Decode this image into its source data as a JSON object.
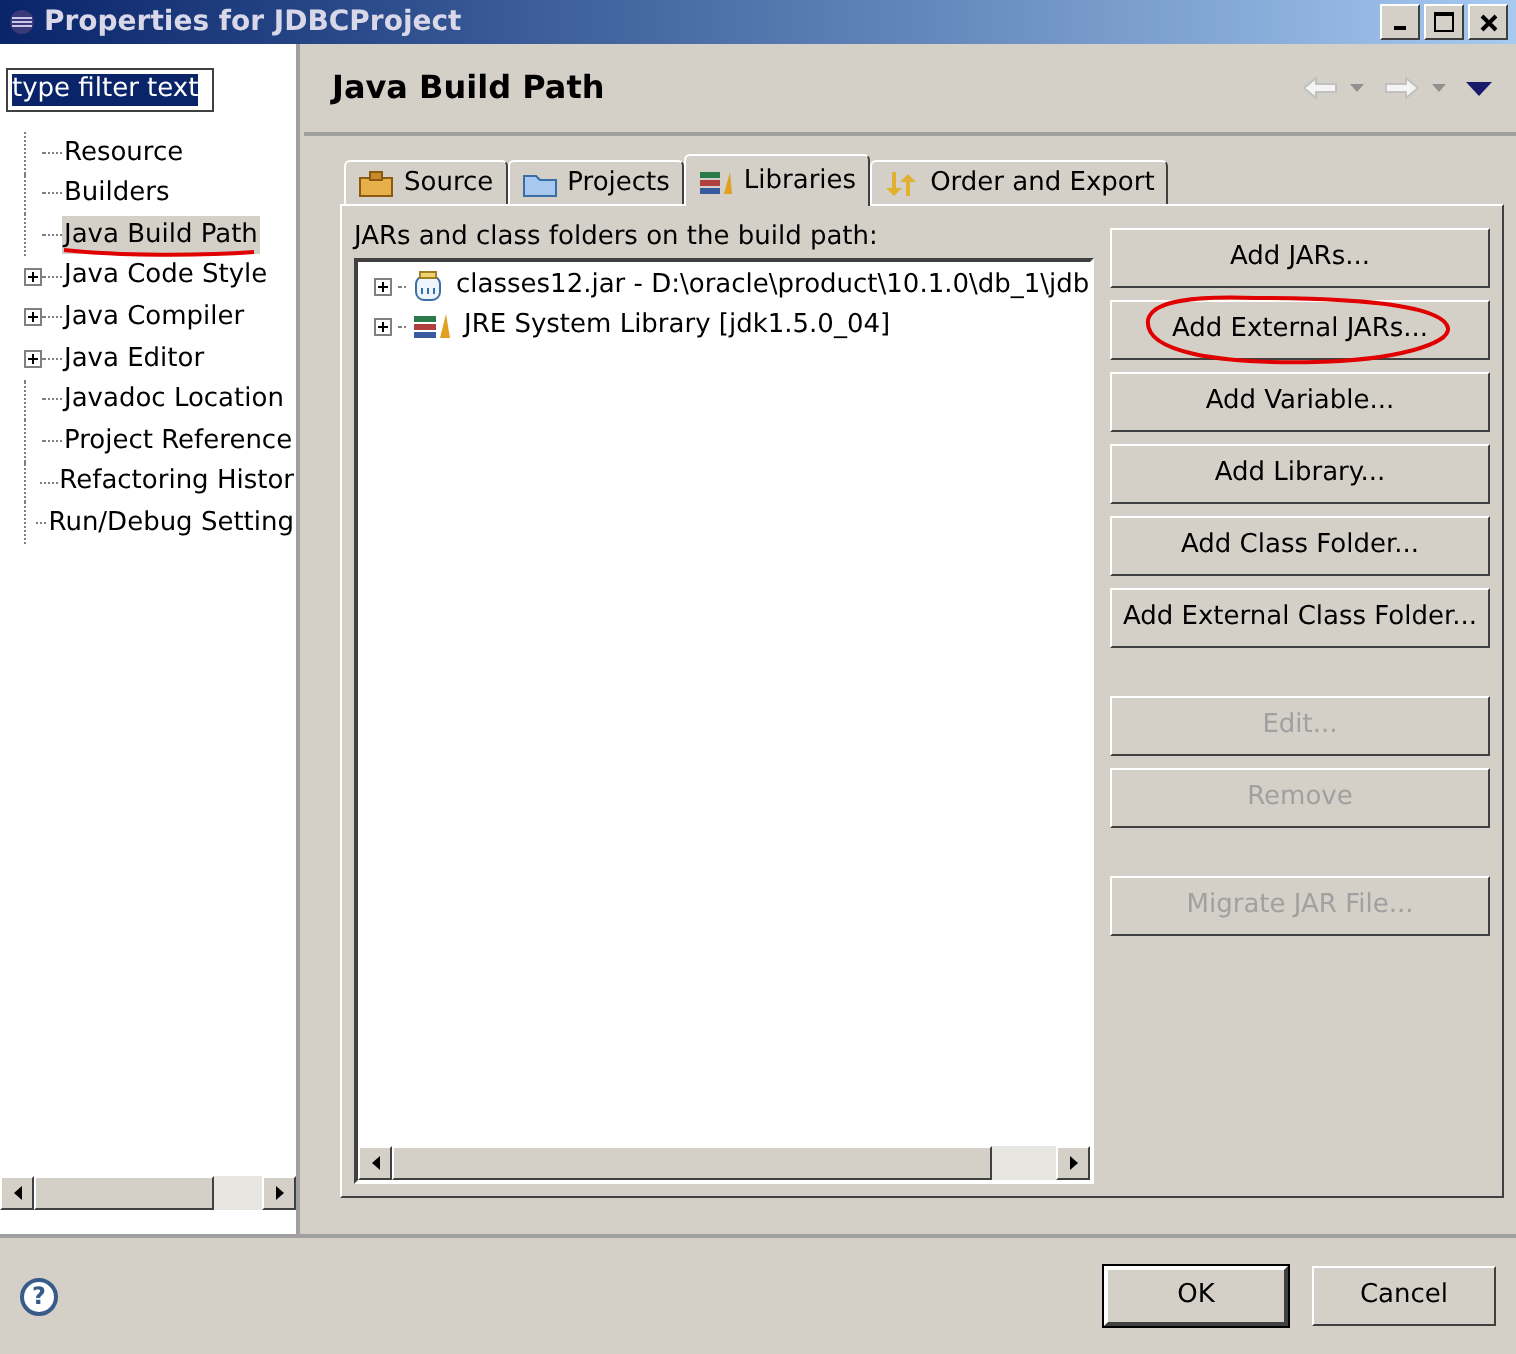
{
  "window": {
    "title": "Properties for JDBCProject"
  },
  "filter": {
    "value": "type filter text",
    "selected": true
  },
  "tree": [
    {
      "label": "Resource",
      "expandable": false,
      "selected": false
    },
    {
      "label": "Builders",
      "expandable": false,
      "selected": false
    },
    {
      "label": "Java Build Path",
      "expandable": false,
      "selected": true
    },
    {
      "label": "Java Code Style",
      "expandable": true,
      "selected": false
    },
    {
      "label": "Java Compiler",
      "expandable": true,
      "selected": false
    },
    {
      "label": "Java Editor",
      "expandable": true,
      "selected": false
    },
    {
      "label": "Javadoc Location",
      "expandable": false,
      "selected": false
    },
    {
      "label": "Project Reference",
      "expandable": false,
      "selected": false
    },
    {
      "label": "Refactoring Histor",
      "expandable": false,
      "selected": false
    },
    {
      "label": "Run/Debug Setting",
      "expandable": false,
      "selected": false
    }
  ],
  "page": {
    "title": "Java Build Path"
  },
  "tabs": [
    {
      "label": "Source",
      "kind": "source",
      "selected": false
    },
    {
      "label": "Projects",
      "kind": "projects",
      "selected": false
    },
    {
      "label": "Libraries",
      "kind": "libraries",
      "selected": true
    },
    {
      "label": "Order and Export",
      "kind": "order",
      "selected": false
    }
  ],
  "list_label": "JARs and class folders on the build path:",
  "entries": [
    {
      "label": "classes12.jar - D:\\oracle\\product\\10.1.0\\db_1\\jdb",
      "kind": "jar"
    },
    {
      "label": "JRE System Library [jdk1.5.0_04]",
      "kind": "library"
    }
  ],
  "button_groups": [
    [
      {
        "label": "Add JARs...",
        "disabled": false
      },
      {
        "label": "Add External JARs...",
        "disabled": false
      },
      {
        "label": "Add Variable...",
        "disabled": false
      },
      {
        "label": "Add Library...",
        "disabled": false
      },
      {
        "label": "Add Class Folder...",
        "disabled": false
      },
      {
        "label": "Add External Class Folder...",
        "disabled": false
      }
    ],
    [
      {
        "label": "Edit...",
        "disabled": true
      },
      {
        "label": "Remove",
        "disabled": true
      }
    ],
    [
      {
        "label": "Migrate JAR File...",
        "disabled": true
      }
    ]
  ],
  "help": {
    "glyph": "?"
  },
  "dialog_buttons": [
    {
      "label": "OK",
      "default": true
    },
    {
      "label": "Cancel",
      "default": false
    }
  ]
}
